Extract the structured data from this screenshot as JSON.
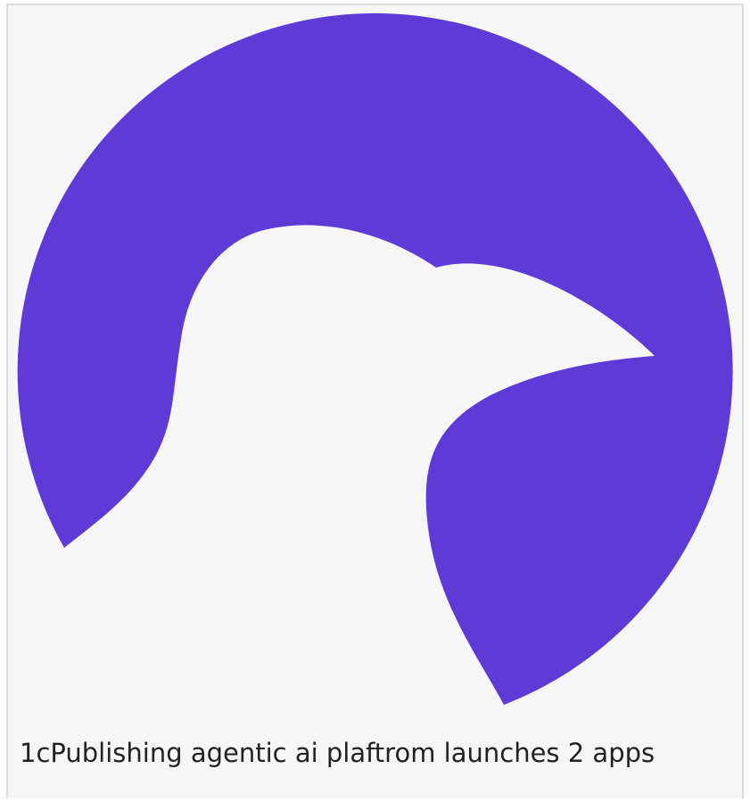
{
  "card": {
    "caption": "1cPublishing agentic ai plaftrom launches 2 apps"
  },
  "logo": {
    "icon": "bird-head-in-circle-icon",
    "color": "#5e3bd6",
    "background": "#f6f6f7"
  }
}
